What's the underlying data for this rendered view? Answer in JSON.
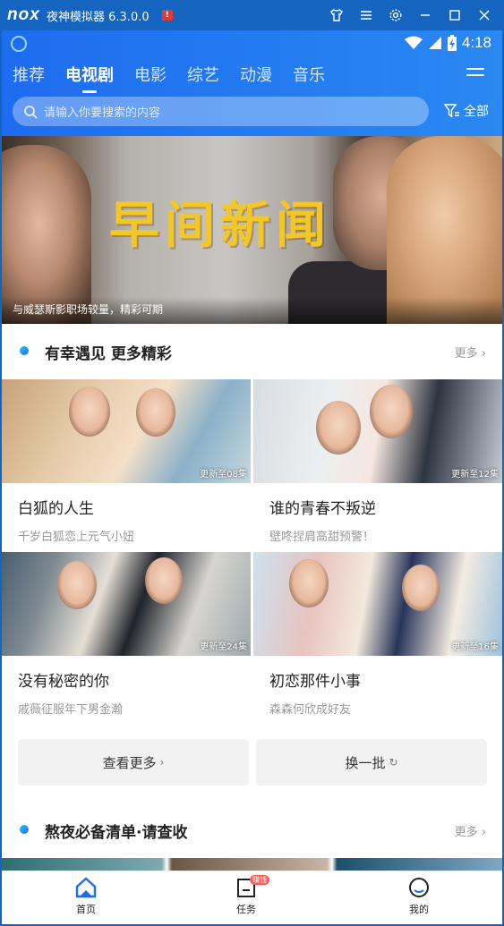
{
  "window": {
    "title": "夜神模拟器 6.3.0.0",
    "logo_text": "nox"
  },
  "status_bar": {
    "time": "4:18"
  },
  "tabs": [
    {
      "label": "推荐",
      "active": false
    },
    {
      "label": "电视剧",
      "active": true
    },
    {
      "label": "电影",
      "active": false
    },
    {
      "label": "综艺",
      "active": false
    },
    {
      "label": "动漫",
      "active": false
    },
    {
      "label": "音乐",
      "active": false
    }
  ],
  "search": {
    "placeholder": "请输入你要搜索的内容"
  },
  "filter": {
    "label": "全部"
  },
  "banner": {
    "title": "早间新闻",
    "caption": "与威瑟斯影职场较量，精彩可期"
  },
  "section1": {
    "title": "有幸遇见 更多精彩",
    "more": "更多",
    "items": [
      {
        "title": "白狐的人生",
        "subtitle": "千岁白狐恋上元气小妞",
        "badge": "更新至08集"
      },
      {
        "title": "谁的青春不叛逆",
        "subtitle": "壁咚捏肩高甜预警！",
        "badge": "更新至12集"
      },
      {
        "title": "没有秘密的你",
        "subtitle": "戚薇征服年下男金瀚",
        "badge": "更新至24集"
      },
      {
        "title": "初恋那件小事",
        "subtitle": "森森何欣成好友",
        "badge": "更新至16集"
      }
    ],
    "see_more": "查看更多",
    "refresh": "换一批"
  },
  "section2": {
    "title": "熬夜必备清单·请查收",
    "more": "更多"
  },
  "bottom_nav": [
    {
      "label": "首页",
      "active": true
    },
    {
      "label": "任务",
      "badge": "赚钱"
    },
    {
      "label": "我的"
    }
  ],
  "colors": {
    "accent": "#1E6CF0",
    "titlebar": "#1565C0",
    "banner_title": "#F4C728"
  }
}
